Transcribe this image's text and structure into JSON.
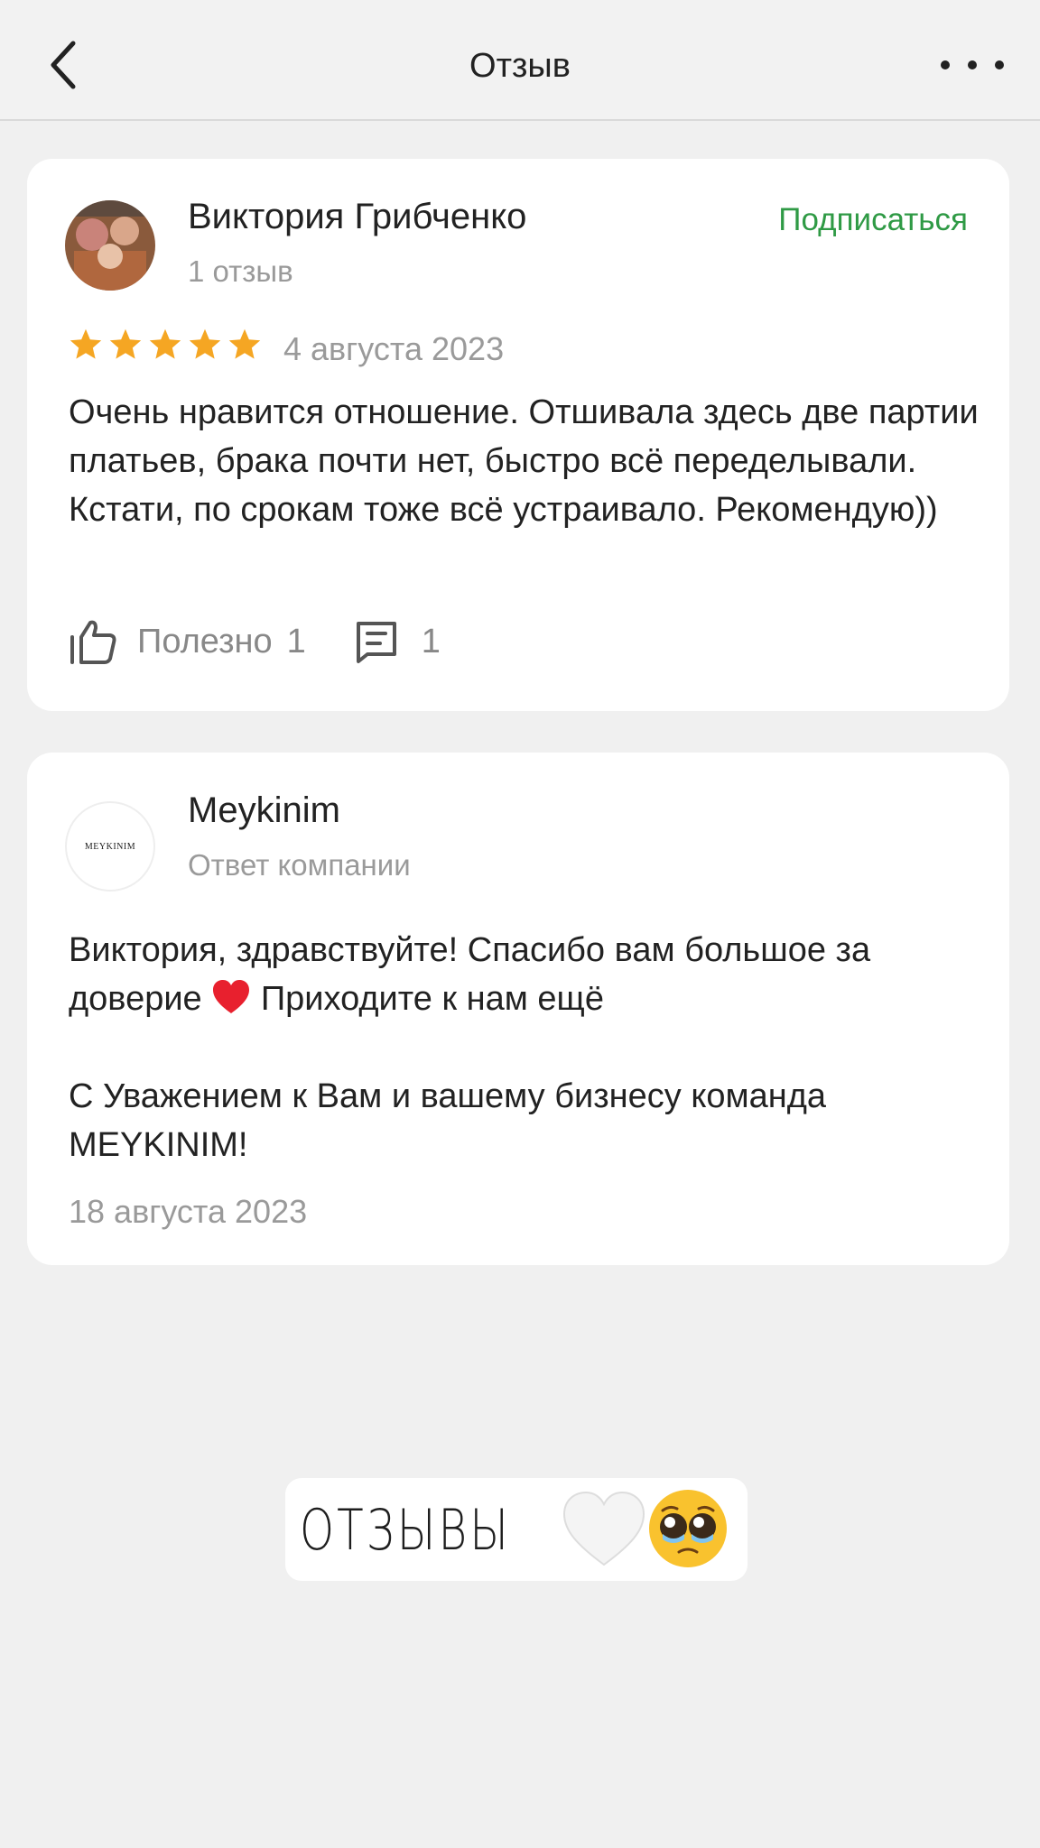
{
  "header": {
    "title": "Отзыв",
    "back_icon": "chevron-left-icon",
    "more_icon": "more-horizontal-icon"
  },
  "review": {
    "author": "Виктория Грибченко",
    "author_meta": "1 отзыв",
    "subscribe_label": "Подписаться",
    "rating": 5,
    "rating_max": 5,
    "date": "4 августа 2023",
    "text": "Очень нравится отношение. Отшивала здесь две партии платьев, брака почти нет, быстро всё переделывали. Кстати, по срокам тоже всё устраивало. Рекомендую))",
    "useful_label": "Полезно",
    "useful_count": "1",
    "comments_count": "1"
  },
  "reply": {
    "company": "Meykinim",
    "company_meta": "Ответ компании",
    "logo_text": "MEYKINIM",
    "text_line1": "Виктория, здравствуйте! Спасибо вам большое за доверие",
    "text_line1_tail": "Приходите к нам ещё",
    "text_line2": "С Уважением к Вам и вашему бизнесу команда MEYKINIM!",
    "date": "18 августа 2023"
  },
  "sticker": {
    "text": "ОТЗЫВЫ"
  },
  "colors": {
    "background": "#f0f0f0",
    "card": "#ffffff",
    "accent_green": "#2f9a45",
    "star": "#f5a623",
    "muted_text": "#9a9a9a"
  }
}
